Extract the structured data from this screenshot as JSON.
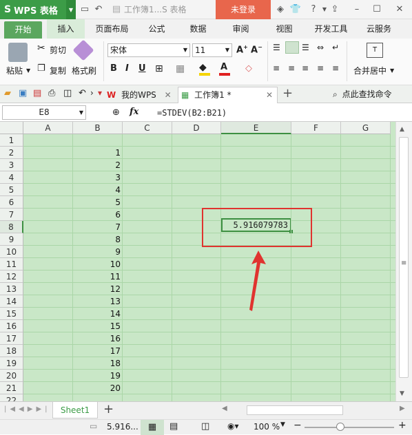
{
  "titlebar": {
    "app_name": "WPS 表格",
    "doc_title": "工作簿1...S 表格",
    "login_label": "未登录"
  },
  "ribbon_tabs": [
    "开始",
    "插入",
    "页面布局",
    "公式",
    "数据",
    "审阅",
    "视图",
    "开发工具",
    "云服务"
  ],
  "ribbon": {
    "paste": "粘贴",
    "cut": "剪切",
    "copy": "复制",
    "format_painter": "格式刷",
    "font_name": "宋体",
    "font_size": "11",
    "merge_center": "合并居中"
  },
  "doc_tabs": {
    "mywps": "我的WPS",
    "workbook": "工作簿1 *",
    "search": "点此查找命令"
  },
  "formula_bar": {
    "name_box": "E8",
    "fx": "fx",
    "formula": "=STDEV(B2:B21)"
  },
  "columns": [
    "A",
    "B",
    "C",
    "D",
    "E",
    "F",
    "G"
  ],
  "rows": [
    "1",
    "2",
    "3",
    "4",
    "5",
    "6",
    "7",
    "8",
    "9",
    "10",
    "11",
    "12",
    "13",
    "14",
    "15",
    "16",
    "17",
    "18",
    "19",
    "20",
    "21",
    "22"
  ],
  "column_b_values": [
    "",
    "1",
    "2",
    "3",
    "4",
    "5",
    "6",
    "7",
    "8",
    "9",
    "10",
    "11",
    "12",
    "13",
    "14",
    "15",
    "16",
    "17",
    "18",
    "19",
    "20",
    ""
  ],
  "result_cell": "5.916079783",
  "sheet_tab": "Sheet1",
  "status": {
    "sum_preview": "5.916...",
    "zoom": "100 %"
  },
  "colors": {
    "accent": "#3c9c47",
    "grid_bg": "#c9e7c7",
    "annotation": "#e0332f"
  }
}
